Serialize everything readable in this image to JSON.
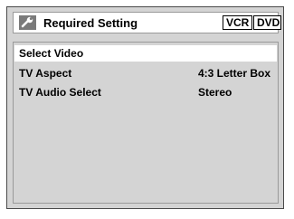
{
  "header": {
    "title": "Required Setting",
    "icon": "wrench-icon",
    "badges": [
      "VCR",
      "DVD"
    ]
  },
  "menu": {
    "items": [
      {
        "label": "Select Video",
        "value": ""
      },
      {
        "label": "TV Aspect",
        "value": "4:3 Letter Box"
      },
      {
        "label": "TV Audio Select",
        "value": "Stereo"
      }
    ],
    "selected_index": 0
  },
  "colors": {
    "background": "#d4d4d4",
    "highlight": "#ffffff",
    "icon": "#7a7a7a",
    "text": "#000000"
  }
}
